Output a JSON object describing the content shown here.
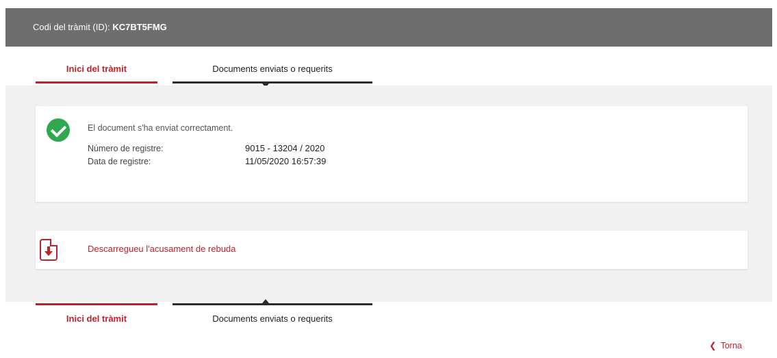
{
  "header": {
    "id_label": "Codi del tràmit (ID):",
    "id_value": "KC7BT5FMG"
  },
  "tabs_top": [
    {
      "label": "Inici del tràmit",
      "active": true
    },
    {
      "label": "Documents enviats o requerits",
      "active": false
    }
  ],
  "status_card": {
    "message": "El document s'ha enviat correctament.",
    "rows": [
      {
        "label": "Número de registre:",
        "value": "9015 - 13204 / 2020"
      },
      {
        "label": "Data de registre:",
        "value": "11/05/2020 16:57:39"
      }
    ]
  },
  "download": {
    "label": "Descarregueu l'acusament de rebuda"
  },
  "tabs_bottom": [
    {
      "label": "Inici del tràmit",
      "active": true
    },
    {
      "label": "Documents enviats o requerits",
      "active": false
    }
  ],
  "back": {
    "label": "Torna"
  },
  "colors": {
    "accent": "#c0202a",
    "header_bg": "#6e6e6e",
    "success": "#2fa84f",
    "panel_bg": "#f1f1f1"
  },
  "icons": [
    "check-circle-icon",
    "pdf-download-icon",
    "chevron-left-icon"
  ]
}
